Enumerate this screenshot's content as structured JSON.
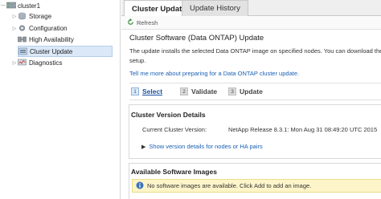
{
  "tree": {
    "items": [
      {
        "label": "cluster1",
        "icon": "cluster-icon",
        "expander": "minus"
      },
      {
        "label": "Storage",
        "icon": "storage-icon",
        "expander": "collapsed"
      },
      {
        "label": "Configuration",
        "icon": "configuration-icon",
        "expander": "collapsed"
      },
      {
        "label": "High Availability",
        "icon": "high-availability-icon",
        "expander": "none"
      },
      {
        "label": "Cluster Update",
        "icon": "cluster-update-icon",
        "expander": "none",
        "selected": true
      },
      {
        "label": "Diagnostics",
        "icon": "diagnostics-icon",
        "expander": "collapsed"
      }
    ]
  },
  "tabs": [
    {
      "label": "Cluster Update",
      "active": true
    },
    {
      "label": "Update History",
      "active": false
    }
  ],
  "toolbar": {
    "refresh_label": "Refresh"
  },
  "page": {
    "title": "Cluster Software (Data ONTAP) Update",
    "description_line1": "The update installs the selected Data ONTAP image on specified nodes. You can download the",
    "description_line2": "setup.",
    "learn_more": "Tell me more about preparing for a Data ONTAP cluster update."
  },
  "steps": [
    {
      "num": "1",
      "label": "Select",
      "current": true
    },
    {
      "num": "2",
      "label": "Validate",
      "current": false
    },
    {
      "num": "3",
      "label": "Update",
      "current": false
    }
  ],
  "cluster_version": {
    "title": "Cluster Version Details",
    "label": "Current Cluster Version:",
    "value": "NetApp Release 8.3.1: Mon Aug 31 08:49:20 UTC 2015",
    "show_link": "Show version details for nodes or HA pairs"
  },
  "software_images": {
    "title": "Available Software Images",
    "notice": "No software images are available. Click Add to add an image."
  },
  "colors": {
    "link": "#1a5fb4",
    "selected_row": "#dbe8f7",
    "notice_bg": "#fdf5c9"
  }
}
